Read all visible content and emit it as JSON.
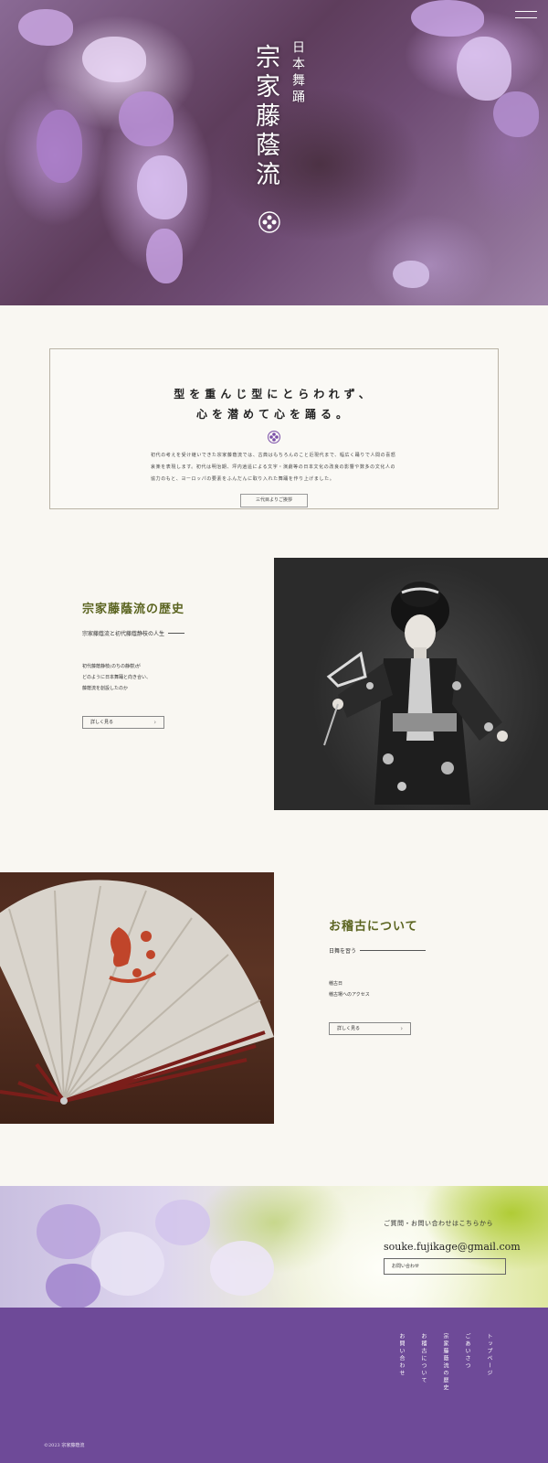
{
  "hero": {
    "subtitle": "日本舞踊",
    "title": "宗家藤蔭流"
  },
  "intro": {
    "heading_line1": "型を重んじ型にとらわれず、",
    "heading_line2": "心を潜めて心を踊る。",
    "body": "初代の考えを受け継いできた宗家藤蔭流では、古典はもちろんのこと近現代まで、幅広く踊りで人間の喜怒哀楽を表現します。初代は明治期、坪内逍遥による文字・演劇等の日本文化の改良の影響や数多の文化人の協力のもと、ヨーロッパの要素をふんだんに取り入れた舞踊を作り上げました。",
    "button_label": "三代目よりご挨拶"
  },
  "history": {
    "title": "宗家藤蔭流の歴史",
    "subtitle": "宗家藤蔭流と初代藤蔭静枝の人生",
    "body_line1": "初代藤蔭静枝(のちの静樹)が",
    "body_line2": "どのように日本舞踊と向き合い、",
    "body_line3": "藤蔭流を創設したのか",
    "button_label": "詳しく見る"
  },
  "practice": {
    "title": "お稽古について",
    "subtitle": "日舞を習う",
    "body_line1": "稽古日",
    "body_line2": "稽古場へのアクセス",
    "button_label": "詳しく見る"
  },
  "contact": {
    "label": "ご質問・お問い合わせはこちらから",
    "email": "souke.fujikage@gmail.com",
    "button_label": "お問い合わせ"
  },
  "footer": {
    "nav": [
      "トップページ",
      "ごあいさつ",
      "宗家藤蔭流の歴史",
      "お稽古について",
      "お問い合わせ"
    ],
    "copyright": "©2023 宗家藤蔭流"
  },
  "icons": {
    "menu": "hamburger-menu-icon",
    "crest": "wisteria-crest-icon",
    "arrow": "chevron-right-icon"
  },
  "colors": {
    "accent_green": "#5b6420",
    "footer_purple": "#6e4a98",
    "background": "#f9f7f2"
  }
}
